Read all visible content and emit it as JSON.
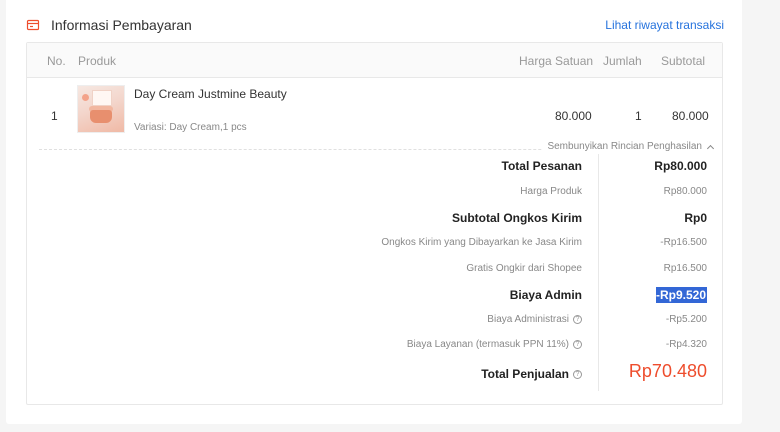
{
  "header": {
    "title": "Informasi Pembayaran",
    "history_link": "Lihat riwayat transaksi",
    "icon": "receipt-icon",
    "accent_color": "#ee4d2d",
    "link_color": "#2673dd"
  },
  "table": {
    "columns": {
      "no": "No.",
      "product": "Produk",
      "unit_price": "Harga Satuan",
      "qty": "Jumlah",
      "subtotal": "Subtotal"
    },
    "rows": [
      {
        "no": "1",
        "name": "Day Cream Justmine Beauty",
        "variant": "Variasi: Day Cream,1 pcs",
        "unit_price": "80.000",
        "qty": "1",
        "subtotal": "80.000"
      }
    ]
  },
  "summary": {
    "toggle_label": "Sembunyikan Rincian Penghasilan",
    "total_pesanan_label": "Total Pesanan",
    "total_pesanan": "Rp80.000",
    "harga_produk_label": "Harga Produk",
    "harga_produk": "Rp80.000",
    "subtotal_ongkir_label": "Subtotal Ongkos Kirim",
    "subtotal_ongkir": "Rp0",
    "ongkir_dibayar_label": "Ongkos Kirim yang Dibayarkan ke Jasa Kirim",
    "ongkir_dibayar": "-Rp16.500",
    "gratis_ongkir_label": "Gratis Ongkir dari Shopee",
    "gratis_ongkir": "Rp16.500",
    "biaya_admin_label": "Biaya Admin",
    "biaya_admin": "-Rp9.520",
    "biaya_administrasi_label": "Biaya Administrasi",
    "biaya_administrasi": "-Rp5.200",
    "biaya_layanan_label": "Biaya Layanan (termasuk PPN 11%)",
    "biaya_layanan": "-Rp4.320",
    "total_penjualan_label": "Total Penjualan",
    "total_penjualan": "Rp70.480",
    "total_color": "#ee4d2d"
  }
}
